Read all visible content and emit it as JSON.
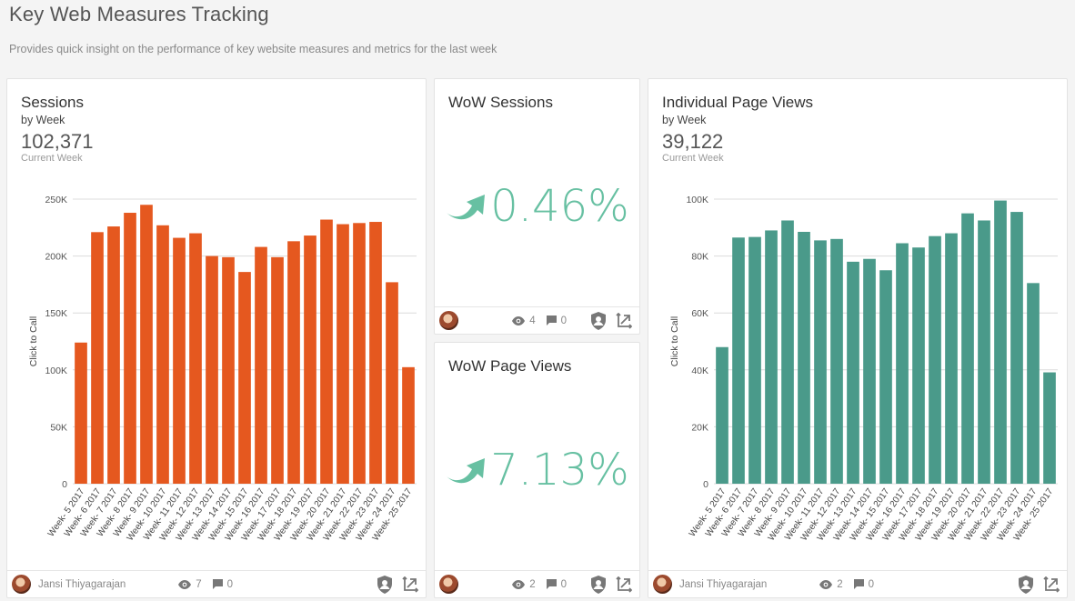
{
  "page": {
    "title": "Key Web Measures Tracking",
    "subtitle": "Provides quick insight on the performance of key website measures and metrics for the last week"
  },
  "sessions_card": {
    "title": "Sessions",
    "subtitle": "by Week",
    "value": "102,371",
    "value_label": "Current Week",
    "footer": {
      "author": "Jansi Thiyagarajan",
      "views": "7",
      "comments": "0"
    }
  },
  "wow_sessions_card": {
    "title": "WoW Sessions",
    "value": "0.46%",
    "footer": {
      "views": "4",
      "comments": "0"
    }
  },
  "wow_pageviews_card": {
    "title": "WoW Page Views",
    "value": "7.13%",
    "footer": {
      "views": "2",
      "comments": "0"
    }
  },
  "pageviews_card": {
    "title": "Individual Page Views",
    "subtitle": "by Week",
    "value": "39,122",
    "value_label": "Current Week",
    "footer": {
      "author": "Jansi Thiyagarajan",
      "views": "2",
      "comments": "0"
    }
  },
  "colors": {
    "sessions_bar": "#e5581f",
    "pageviews_bar": "#4a9a8a",
    "kpi": "#67c0a2"
  },
  "icons": [
    "trend-up-arrow-icon",
    "eye-icon",
    "comment-icon",
    "shield-user-icon",
    "resize-arrows-icon"
  ],
  "chart_data": [
    {
      "type": "bar",
      "title": "Sessions",
      "ylabel": "Click to Call",
      "ylim": [
        0,
        250000
      ],
      "yticks": [
        "0",
        "50K",
        "100K",
        "150K",
        "200K",
        "250K"
      ],
      "ytick_values": [
        0,
        50000,
        100000,
        150000,
        200000,
        250000
      ],
      "categories": [
        "Week- 5 2017",
        "Week- 6 2017",
        "Week- 7 2017",
        "Week- 8 2017",
        "Week- 9 2017",
        "Week- 10 2017",
        "Week- 11 2017",
        "Week- 12 2017",
        "Week- 13 2017",
        "Week- 14 2017",
        "Week- 15 2017",
        "Week- 16 2017",
        "Week- 17 2017",
        "Week- 18 2017",
        "Week- 19 2017",
        "Week- 20 2017",
        "Week- 21 2017",
        "Week- 22 2017",
        "Week- 23 2017",
        "Week- 24 2017",
        "Week- 25 2017"
      ],
      "values": [
        124000,
        221000,
        226000,
        238000,
        245000,
        227000,
        216000,
        220000,
        200000,
        199000,
        186000,
        208000,
        199000,
        213000,
        218000,
        232000,
        228000,
        229000,
        230000,
        177000,
        102371
      ],
      "grid": true,
      "color": "#e5581f"
    },
    {
      "type": "bar",
      "title": "Individual Page Views",
      "ylabel": "Click to Call",
      "ylim": [
        0,
        100000
      ],
      "yticks": [
        "0",
        "20K",
        "40K",
        "60K",
        "80K",
        "100K"
      ],
      "ytick_values": [
        0,
        20000,
        40000,
        60000,
        80000,
        100000
      ],
      "categories": [
        "Week- 5 2017",
        "Week- 6 2017",
        "Week- 7 2017",
        "Week- 8 2017",
        "Week- 9 2017",
        "Week- 10 2017",
        "Week- 11 2017",
        "Week- 12 2017",
        "Week- 13 2017",
        "Week- 14 2017",
        "Week- 15 2017",
        "Week- 16 2017",
        "Week- 17 2017",
        "Week- 18 2017",
        "Week- 19 2017",
        "Week- 20 2017",
        "Week- 21 2017",
        "Week- 22 2017",
        "Week- 23 2017",
        "Week- 24 2017",
        "Week- 25 2017"
      ],
      "values": [
        48000,
        86500,
        86700,
        89000,
        92500,
        88500,
        85500,
        86000,
        78000,
        79000,
        75000,
        84500,
        83000,
        87000,
        88000,
        95000,
        92500,
        99500,
        95500,
        70500,
        39122
      ],
      "grid": true,
      "color": "#4a9a8a"
    }
  ]
}
